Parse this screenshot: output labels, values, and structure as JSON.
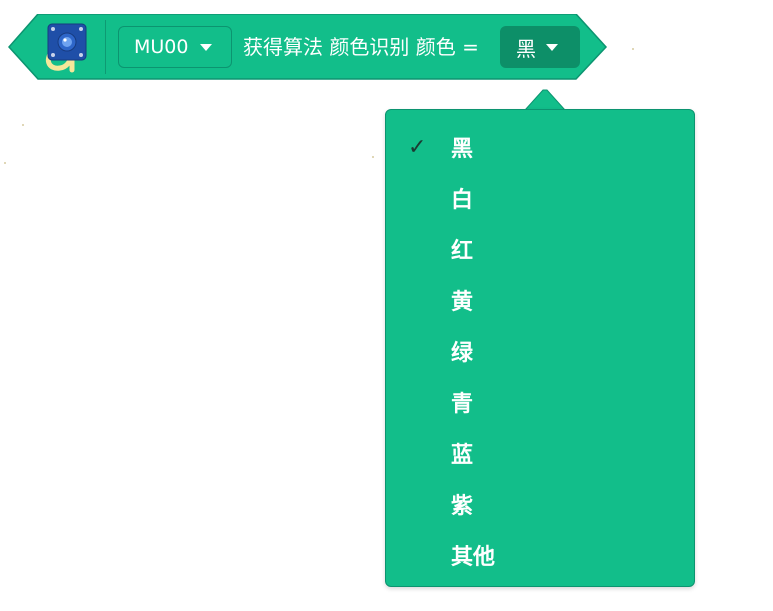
{
  "block": {
    "sensor_value": "MU00",
    "label": "获得算法 颜色识别 颜色 =",
    "selected_color": "黑",
    "fill_color": "#12be8a",
    "border_color": "#0c9470",
    "icon": "mu-vision-sensor-icon"
  },
  "menu": {
    "items": [
      {
        "label": "黑",
        "selected": true
      },
      {
        "label": "白",
        "selected": false
      },
      {
        "label": "红",
        "selected": false
      },
      {
        "label": "黄",
        "selected": false
      },
      {
        "label": "绿",
        "selected": false
      },
      {
        "label": "青",
        "selected": false
      },
      {
        "label": "蓝",
        "selected": false
      },
      {
        "label": "紫",
        "selected": false
      },
      {
        "label": "其他",
        "selected": false
      }
    ],
    "checkmark": "✓"
  }
}
